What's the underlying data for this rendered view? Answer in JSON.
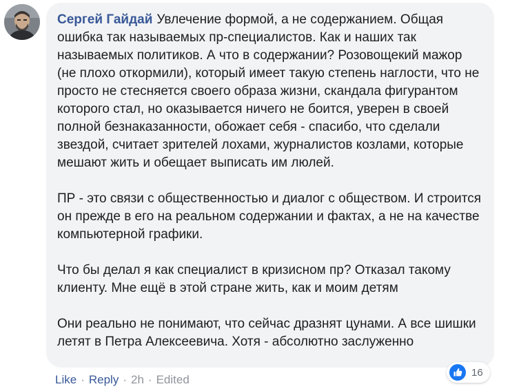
{
  "comment": {
    "author": "Сергей Гайдай",
    "first_text": "Увлечение формой, а не содержанием. Общая ошибка так называемых пр-специалистов. Как и наших так называемых политиков. А что в содержании? Розовощекий мажор (не плохо откормили), который имеет такую степень наглости, что не просто не стесняется своего образа жизни, скандала фигурантом которого стал, но оказывается ничего не боится, уверен в своей полной безнаказанности, обожает себя - спасибо, что сделали звездой, считает зрителей лохами, журналистов козлами, которые мешают жить и обещает выписать им люлей.",
    "paragraphs": [
      "ПР - это связи с общественностью и диалог с обществом. И строится он прежде в его на реальном содержании и фактах, а не на качестве компьютерной графики.",
      "Что бы делал я как специалист в кризисном пр? Отказал такому клиенту. Мне ещё в этой стране жить, как и моим детям",
      "Они реально не понимают, что сейчас дразнят цунами. А все шишки летят в Петра Алексеевича. Хотя - абсолютно заслуженно"
    ]
  },
  "reactions": {
    "icon": "like-icon",
    "count": "16",
    "color": "#1877f2"
  },
  "actions": {
    "like": "Like",
    "reply": "Reply",
    "time": "2h",
    "edited": "Edited",
    "separator": "·"
  },
  "colors": {
    "bubble": "#f2f3f5",
    "author": "#385898",
    "text": "#1c1e21",
    "meta": "#90949c"
  }
}
